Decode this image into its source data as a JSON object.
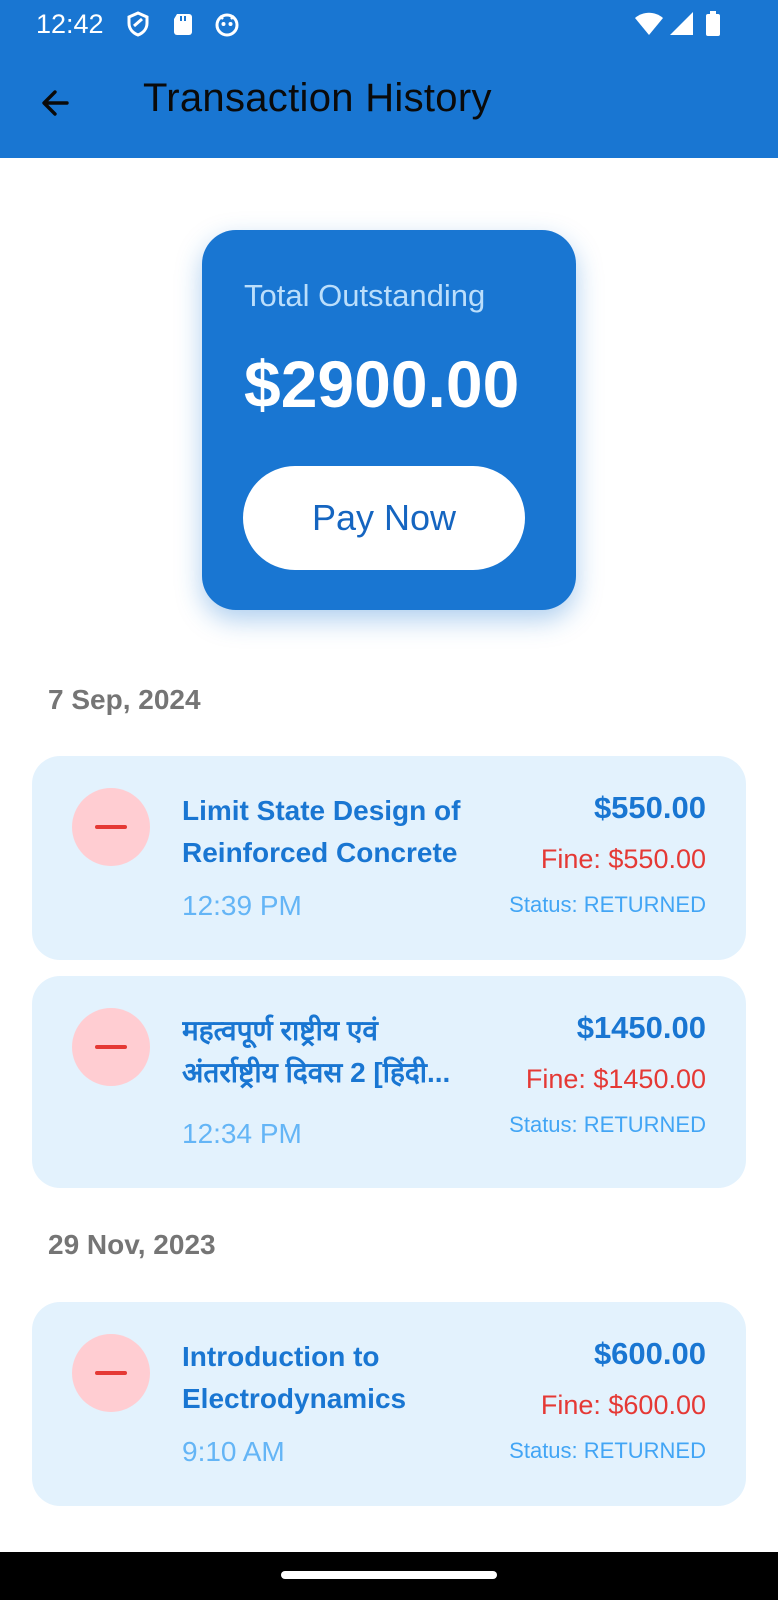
{
  "status_bar": {
    "time": "12:42"
  },
  "app_bar": {
    "title": "Transaction History"
  },
  "summary": {
    "label": "Total Outstanding",
    "amount": "$2900.00",
    "pay_button": "Pay Now"
  },
  "groups": [
    {
      "date": "7 Sep, 2024",
      "transactions": [
        {
          "title_line1": "Limit State Design of",
          "title_line2": "Reinforced Concrete",
          "time": "12:39 PM",
          "amount": "$550.00",
          "fine": "Fine: $550.00",
          "status": "Status: RETURNED"
        },
        {
          "title_line1": "महत्वपूर्ण राष्ट्रीय एवं",
          "title_line2": "अंतर्राष्ट्रीय दिवस 2 [हिंदी...",
          "time": "12:34 PM",
          "amount": "$1450.00",
          "fine": "Fine: $1450.00",
          "status": "Status: RETURNED"
        }
      ]
    },
    {
      "date": "29 Nov, 2023",
      "transactions": [
        {
          "title_line1": "Introduction to",
          "title_line2": "Electrodynamics",
          "time": "9:10 AM",
          "amount": "$600.00",
          "fine": "Fine: $600.00",
          "status": "Status: RETURNED"
        }
      ]
    }
  ],
  "colors": {
    "primary": "#1976D2",
    "card_bg": "#E3F2FD",
    "fine_red": "#E53935",
    "icon_bg": "#FFCDD2"
  },
  "icons": [
    "back-arrow-icon",
    "minus-icon",
    "wifi-icon",
    "signal-icon",
    "battery-icon"
  ]
}
